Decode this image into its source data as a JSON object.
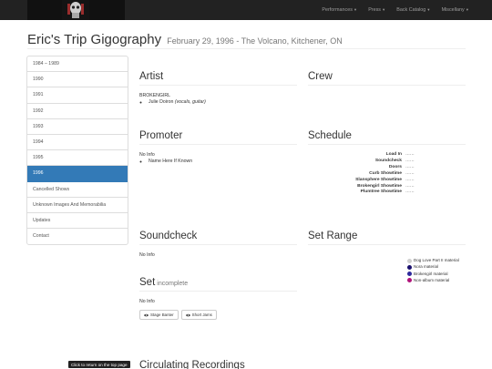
{
  "navbar": {
    "brand_alt": "Eric's Trip",
    "items": [
      {
        "label": "Performances"
      },
      {
        "label": "Press"
      },
      {
        "label": "Back Catalog"
      },
      {
        "label": "Miscellany"
      }
    ],
    "caret": "▾"
  },
  "page": {
    "title": "Eric's Trip Gigography",
    "subtitle": "February 29, 1996 - The Volcano, Kitchener, ON"
  },
  "sidebar": {
    "items": [
      {
        "label": "1984 – 1989"
      },
      {
        "label": "1990"
      },
      {
        "label": "1991"
      },
      {
        "label": "1992"
      },
      {
        "label": "1993"
      },
      {
        "label": "1994"
      },
      {
        "label": "1995"
      },
      {
        "label": "1996"
      },
      {
        "label": "Cancelled Shows"
      },
      {
        "label": "Unknown Images And Memorabilia"
      },
      {
        "label": "Updates"
      },
      {
        "label": "Contact"
      }
    ],
    "active_index": 7
  },
  "artist": {
    "heading": "Artist",
    "name": "BROKENGIRL",
    "member": "Julie Doiron",
    "member_role": "(vocals, guitar)"
  },
  "crew": {
    "heading": "Crew"
  },
  "promoter": {
    "heading": "Promoter",
    "value": "No Info",
    "item": "Name Here If Known"
  },
  "schedule": {
    "heading": "Schedule",
    "rows": [
      {
        "label": "Load In",
        "value": "……"
      },
      {
        "label": "Soundcheck",
        "value": "……"
      },
      {
        "label": "Doors",
        "value": "……"
      },
      {
        "label": "Curb Showtime",
        "value": "……"
      },
      {
        "label": "Slansphere Showtime",
        "value": "……"
      },
      {
        "label": "Brokengirl Showtime",
        "value": "……"
      },
      {
        "label": "Plumtree Showtime",
        "value": "……"
      }
    ]
  },
  "soundcheck": {
    "heading": "Soundcheck",
    "value": "No Info"
  },
  "set_range": {
    "heading": "Set Range",
    "legend": [
      {
        "label": "Dog Love Part II material",
        "color": "#cfcfcf"
      },
      {
        "label": "Nora material",
        "color": "#1a0f6e"
      },
      {
        "label": "Brokengirl material",
        "color": "#2e2a9c"
      },
      {
        "label": "Non-album material",
        "color": "#b0127a"
      }
    ]
  },
  "set": {
    "heading": "Set",
    "status": "incomplete",
    "value": "No Info",
    "buttons": [
      {
        "label": "Stage Banter",
        "icon": "eye-icon"
      },
      {
        "label": "Short Jams",
        "icon": "eye-icon"
      }
    ]
  },
  "footer": {
    "top_link": "Click to return on the top page",
    "next_heading": "Circulating Recordings"
  }
}
